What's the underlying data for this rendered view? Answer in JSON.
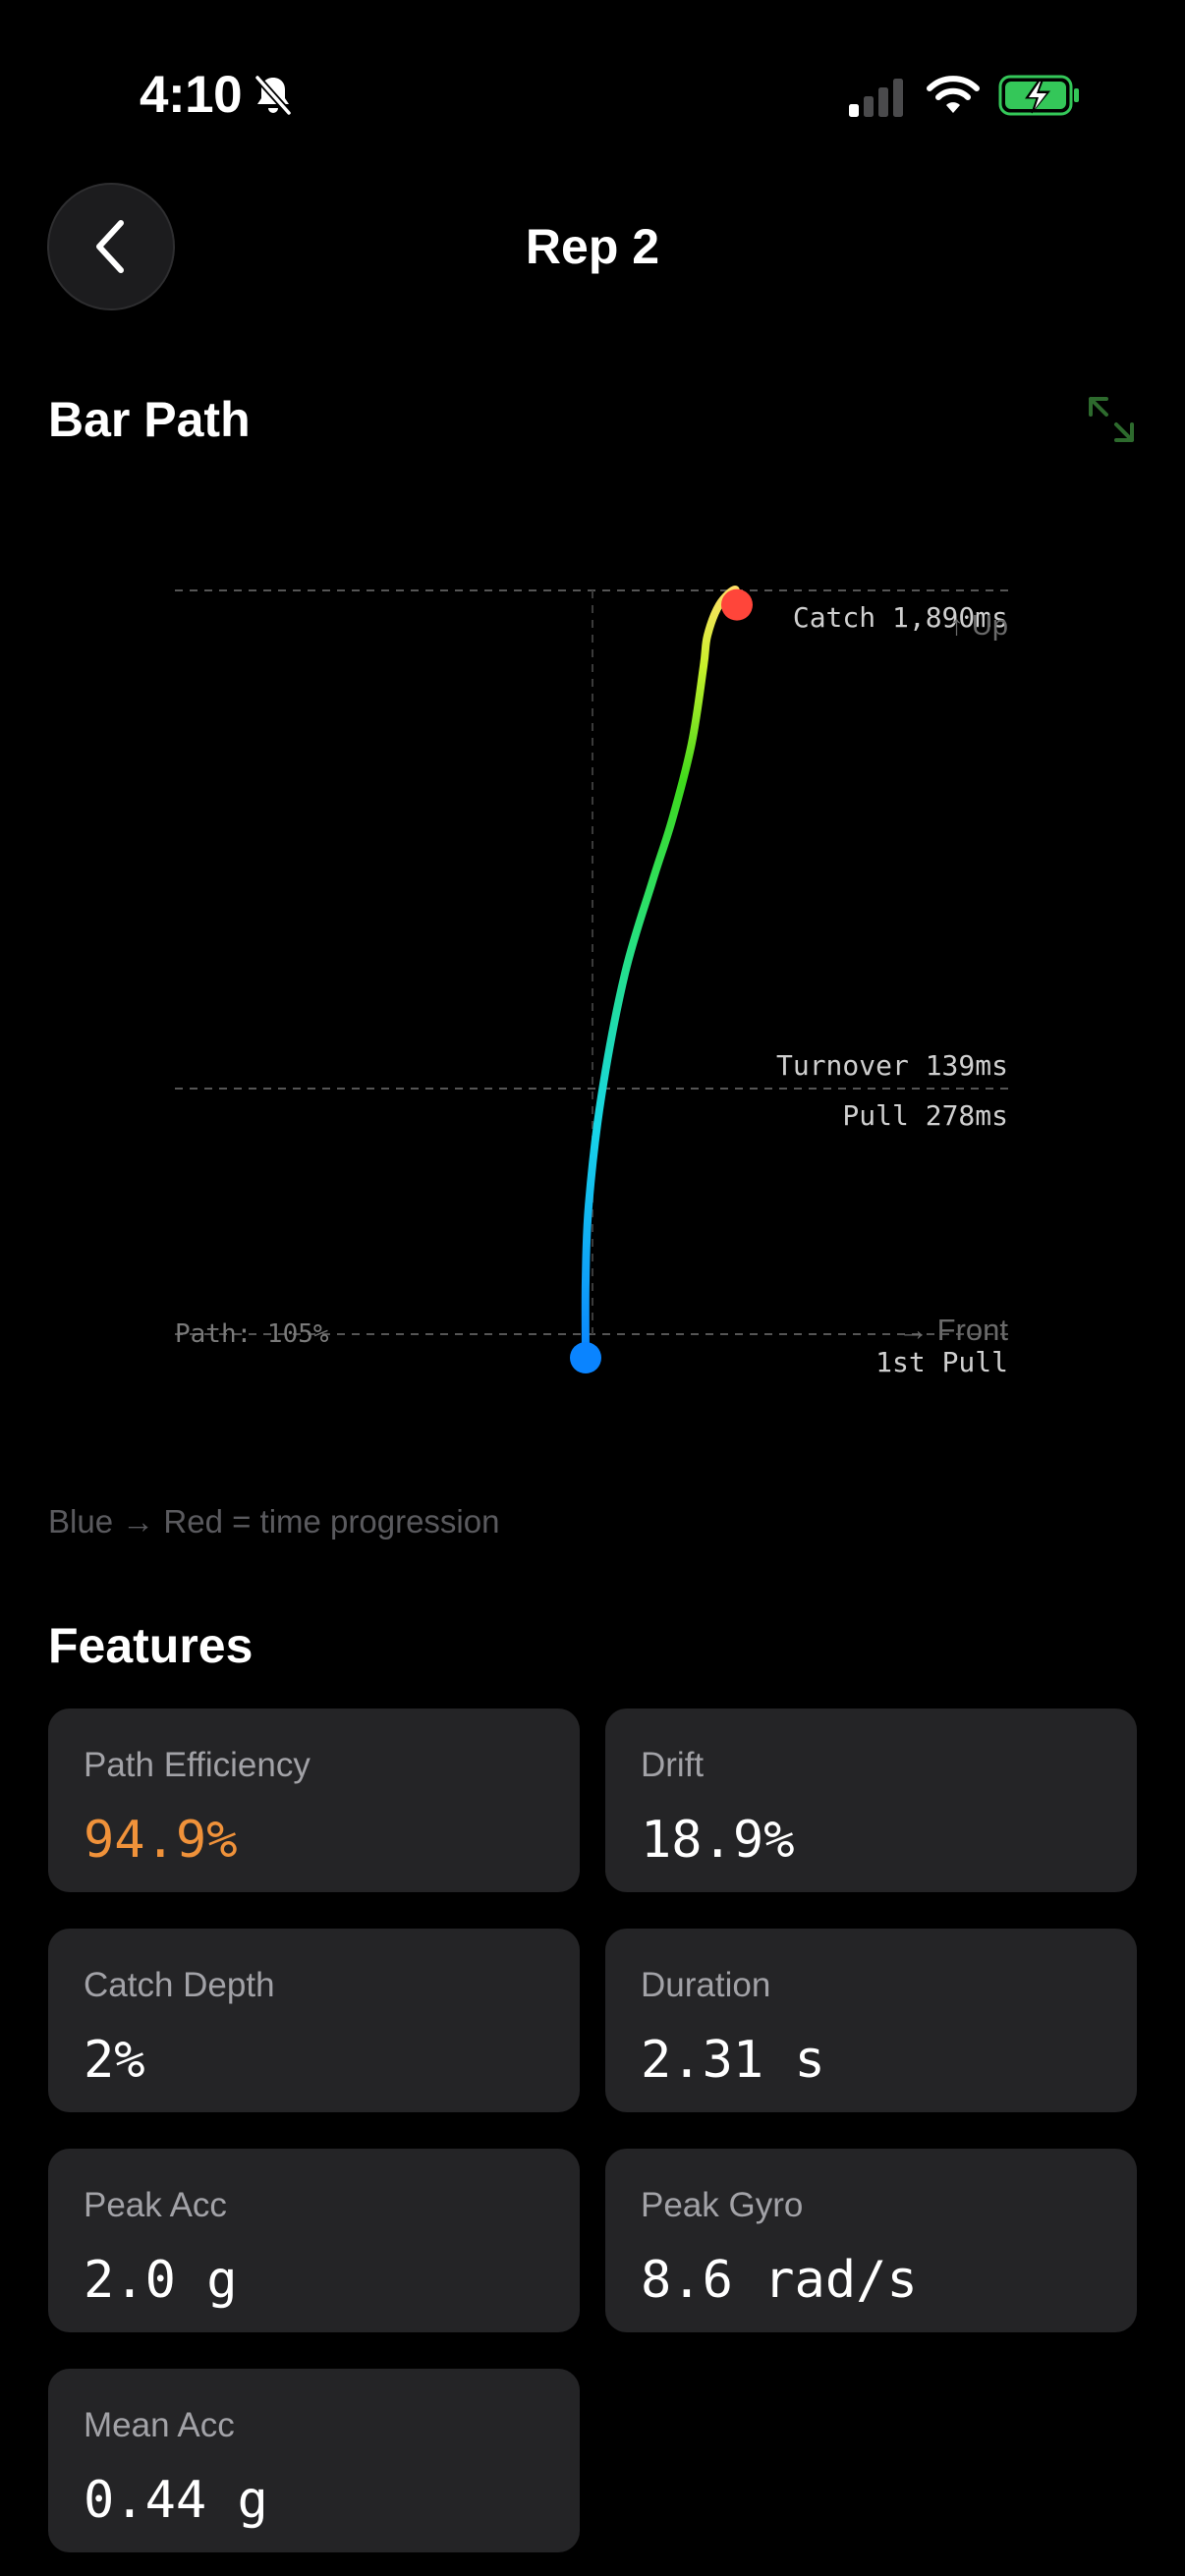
{
  "status_bar": {
    "time": "4:10"
  },
  "header": {
    "title": "Rep 2"
  },
  "bar_path": {
    "section_title": "Bar Path",
    "labels": {
      "catch": "Catch 1,890ms",
      "up": "↑ Up",
      "turnover": "Turnover 139ms",
      "pull": "Pull 278ms",
      "path": "Path: 105%",
      "front": "→ Front",
      "first_pull": "1st Pull"
    },
    "caption": "Blue → Red = time progression"
  },
  "chart_data": {
    "type": "line",
    "title": "Bar Path",
    "xlabel": "→ Front",
    "ylabel": "↑ Up",
    "color_encoding": "Blue → Red = time progression",
    "phase_markers": [
      {
        "label": "Catch 1,890ms",
        "y": 1.0
      },
      {
        "label": "Turnover 139ms",
        "y": 0.34
      },
      {
        "label": "Pull 278ms",
        "y": 0.34
      },
      {
        "label": "1st Pull",
        "y": 0.0
      }
    ],
    "path_label": "Path: 105%",
    "series": [
      {
        "x": [
          0.0,
          0.0,
          0.004,
          0.02,
          0.05,
          0.085,
          0.11,
          0.135,
          0.15,
          0.155,
          0.17,
          0.19,
          0.19
        ],
        "y": [
          0.0,
          0.1,
          0.2,
          0.34,
          0.5,
          0.62,
          0.7,
          0.8,
          0.9,
          0.94,
          0.98,
          1.0,
          0.98
        ]
      }
    ],
    "start_color": "#0a84ff",
    "end_color": "#ff453a"
  },
  "features": {
    "section_title": "Features",
    "items": [
      {
        "label": "Path Efficiency",
        "value": "94.9%",
        "color": "#f0923a"
      },
      {
        "label": "Drift",
        "value": "18.9%",
        "color": "#ffffff"
      },
      {
        "label": "Catch Depth",
        "value": "2%",
        "color": "#ffffff"
      },
      {
        "label": "Duration",
        "value": "2.31 s",
        "color": "#ffffff"
      },
      {
        "label": "Peak Acc",
        "value": "2.0 g",
        "color": "#ffffff"
      },
      {
        "label": "Peak Gyro",
        "value": "8.6 rad/s",
        "color": "#ffffff"
      },
      {
        "label": "Mean Acc",
        "value": "0.44 g",
        "color": "#ffffff"
      }
    ]
  }
}
